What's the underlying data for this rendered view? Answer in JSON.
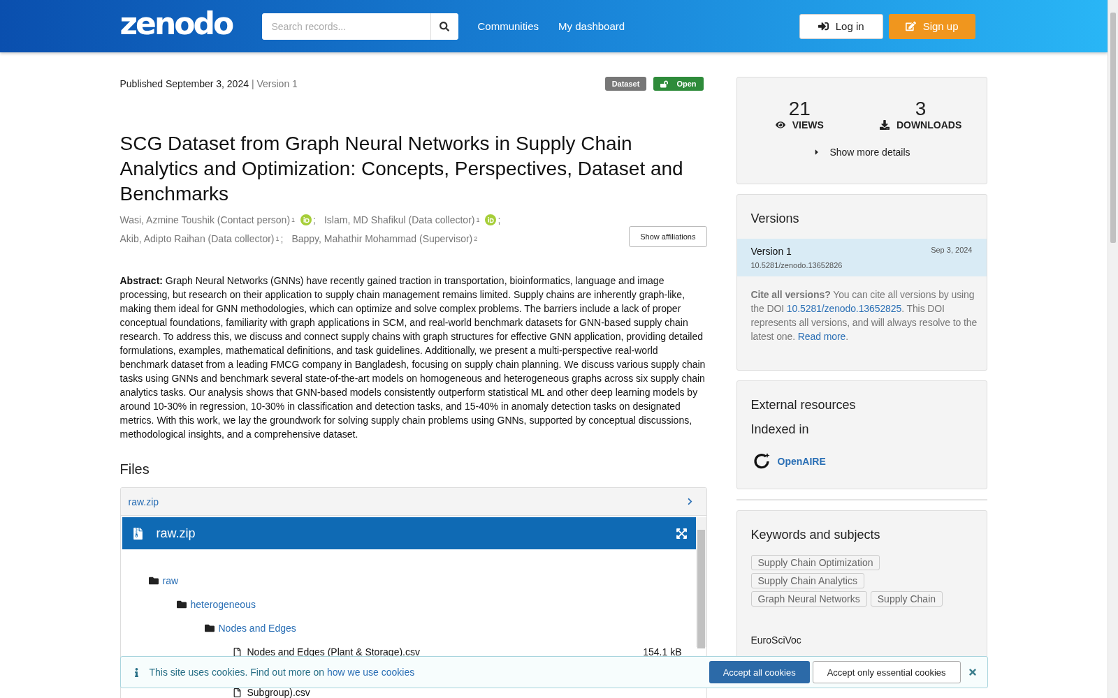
{
  "header": {
    "logo": "zenodo",
    "search": {
      "placeholder": "Search records..."
    },
    "nav": [
      "Communities",
      "My dashboard"
    ],
    "login": "Log in",
    "signup": "Sign up"
  },
  "record": {
    "published": "Published September 3, 2024",
    "version": "| Version 1",
    "badges": [
      {
        "label": "Dataset",
        "kind": "type"
      },
      {
        "label": "Open",
        "kind": "access"
      }
    ],
    "title": "SCG Dataset from Graph Neural Networks in Supply Chain Analytics and Optimization: Concepts, Perspectives, Dataset and Benchmarks",
    "authors": [
      {
        "name": "Wasi, Azmine Toushik (Contact person)",
        "affiliation": "1",
        "orcid": true,
        "separator": ";"
      },
      {
        "name": "Islam, MD Shafikul (Data collector)",
        "affiliation": "1",
        "orcid": true,
        "separator": ";"
      },
      {
        "name": "Akib, Adipto Raihan (Data collector)",
        "affiliation": "1",
        "orcid": false,
        "separator": ";"
      },
      {
        "name": "Bappy, Mahathir Mohammad (Supervisor)",
        "affiliation": "2",
        "orcid": false
      }
    ],
    "show_affiliations": "Show affiliations",
    "abstract": "**Abstract:** Graph Neural Networks (GNNs) have recently gained traction in transportation, bioinformatics, language and image processing, but research on their application to supply chain management remains limited. Supply chains are inherently graph-like, making them ideal for GNN methodologies, which can optimize and solve complex problems. The barriers include a lack of proper conceptual foundations, familiarity with graph applications in SCM, and real-world benchmark datasets for GNN-based supply chain research. To address this, we discuss and connect supply chains with graph structures for effective GNN application, providing detailed formulations, examples, mathematical definitions, and task guidelines. Additionally, we present a multi-perspective real-world benchmark dataset from a leading FMCG company in Bangladesh, focusing on supply chain planning. We discuss various supply chain tasks using GNNs and benchmark several state-of-the-art models on homogeneous and heterogeneous graphs across six supply chain analytics tasks. Our analysis shows that GNN-based models consistently outperform statistical ML and other deep learning models by around 10-30% in regression, 10-30% in classification and detection tasks, and 15-40% in anomaly detection tasks on designated metrics. With this work, we lay the groundwork for solving supply chain problems using GNNs, supported by conceptual discussions, methodological insights, and a comprehensive dataset."
  },
  "files": {
    "heading": "Files",
    "archive": "raw.zip",
    "preview_title": "raw.zip",
    "tree": [
      {
        "kind": "folder",
        "name": "raw",
        "children": [
          {
            "kind": "folder",
            "name": "heterogeneous",
            "children": [
              {
                "kind": "folder",
                "name": "Nodes and Edges",
                "children": [
                  {
                    "kind": "file",
                    "name": "Nodes and Edges (Plant & Storage).csv",
                    "size": "154.1 kB"
                  },
                  {
                    "kind": "file",
                    "name": "Subgroup).csv"
                  }
                ]
              }
            ]
          }
        ]
      }
    ]
  },
  "stats": {
    "views": "21",
    "views_label": "VIEWS",
    "downloads": "3",
    "downloads_label": "DOWNLOADS",
    "more": "Show more details"
  },
  "versions": {
    "heading": "Versions",
    "items": [
      {
        "label": "Version 1",
        "date": "Sep 3, 2024",
        "doi": "10.5281/zenodo.13652826",
        "selected": true
      }
    ],
    "cite": {
      "lead": "Cite all versions?",
      "text1": " You can cite all versions by using the DOI ",
      "doi": "10.5281/zenodo.13652825",
      "text2": ". This DOI represents all versions, and will always resolve to the latest one. ",
      "read_more": "Read more",
      "end": "."
    }
  },
  "external": {
    "heading": "External resources",
    "subheading": "Indexed in",
    "items": [
      "OpenAIRE"
    ]
  },
  "keywords": {
    "heading": "Keywords and subjects",
    "tags": [
      "Supply Chain Optimization",
      "Supply Chain Analytics",
      "Graph Neural Networks",
      "Supply Chain"
    ],
    "vocab": "EuroSciVoc"
  },
  "cookies": {
    "text": "This site uses cookies. Find out more on ",
    "link": "how we use cookies",
    "accept_all": "Accept all cookies",
    "accept_essential": "Accept only essential cookies"
  }
}
